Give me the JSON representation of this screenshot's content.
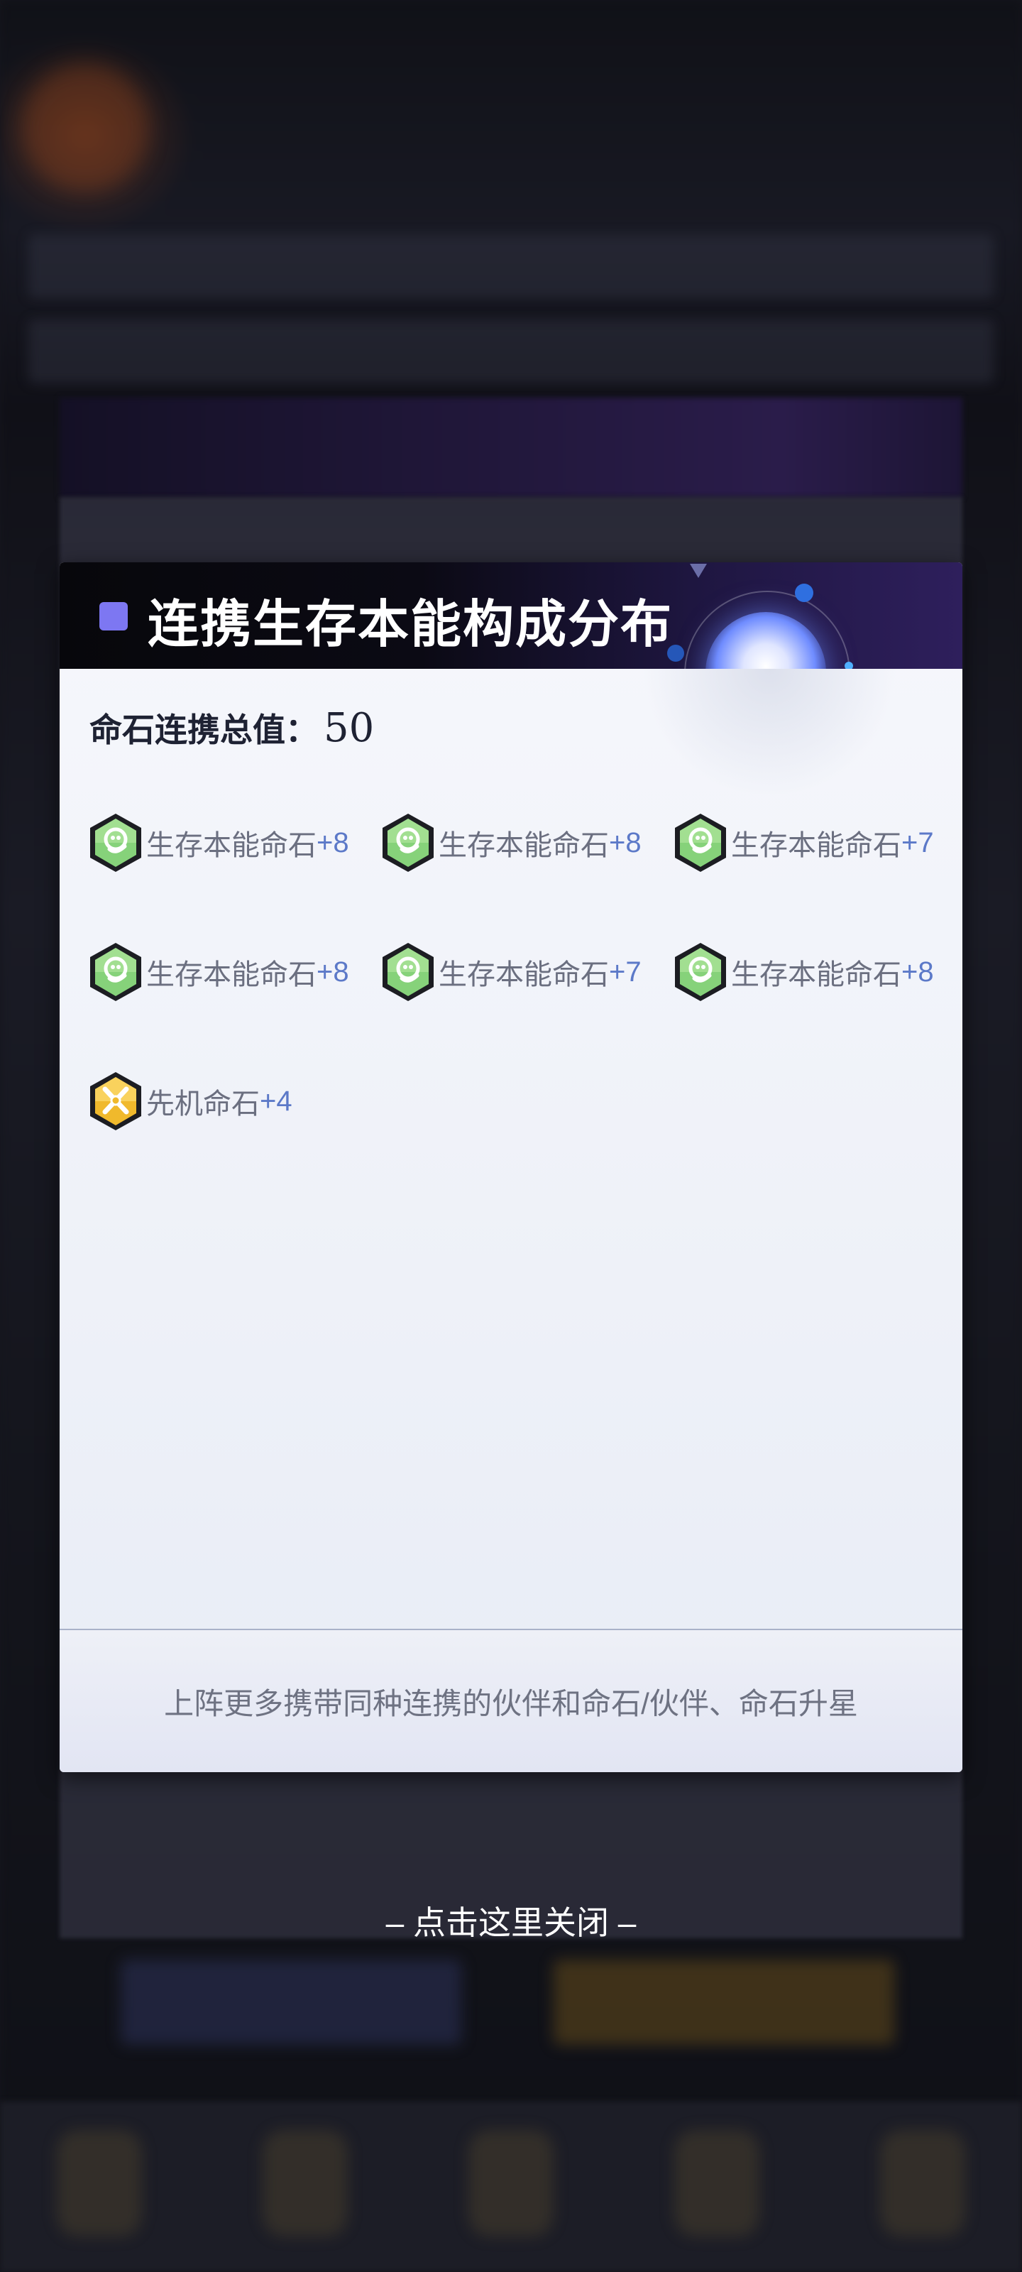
{
  "dialog": {
    "title": "连携生存本能构成分布",
    "total_label": "命石连携总值：",
    "total_value": "50",
    "stones": [
      {
        "name": "生存本能命石",
        "bonus": "+8",
        "icon": "survival-instinct-icon"
      },
      {
        "name": "生存本能命石",
        "bonus": "+8",
        "icon": "survival-instinct-icon"
      },
      {
        "name": "生存本能命石",
        "bonus": "+7",
        "icon": "survival-instinct-icon"
      },
      {
        "name": "生存本能命石",
        "bonus": "+8",
        "icon": "survival-instinct-icon"
      },
      {
        "name": "生存本能命石",
        "bonus": "+7",
        "icon": "survival-instinct-icon"
      },
      {
        "name": "生存本能命石",
        "bonus": "+8",
        "icon": "survival-instinct-icon"
      },
      {
        "name": "先机命石",
        "bonus": "+4",
        "icon": "initiative-icon"
      }
    ],
    "hint": "上阵更多携带同种连携的伙伴和命石/伙伴、命石升星"
  },
  "close_hint": "– 点击这里关闭 –",
  "colors": {
    "accent": "#7d77f2",
    "bonus": "#5c79c8",
    "label": "#6b6f80",
    "green_stone": "#7fcf6e",
    "gold_stone": "#f2c23a"
  }
}
